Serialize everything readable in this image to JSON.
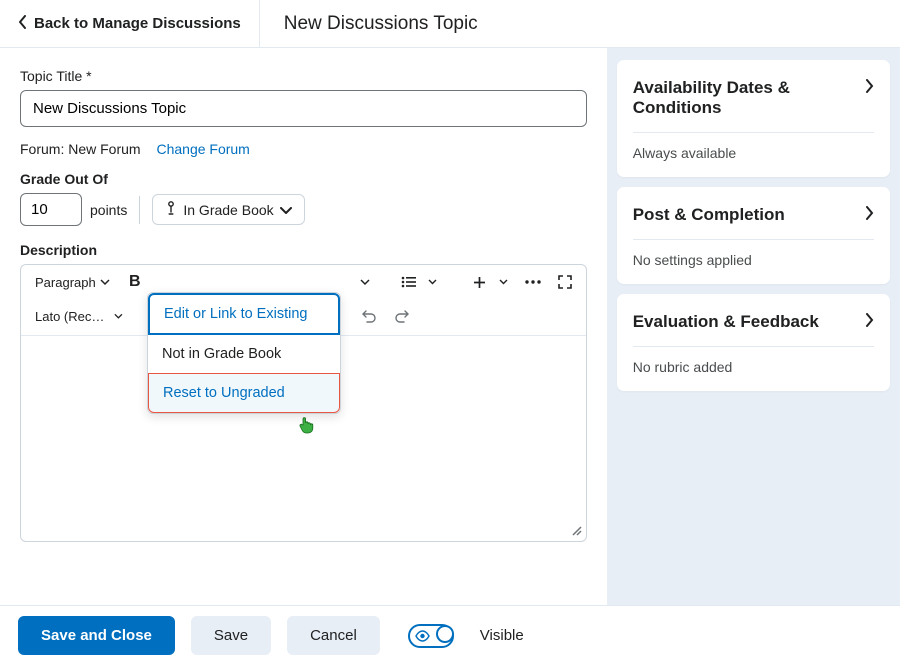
{
  "header": {
    "back_label": "Back to Manage Discussions",
    "page_title": "New Discussions Topic"
  },
  "topic": {
    "title_label": "Topic Title *",
    "title_value": "New Discussions Topic",
    "forum_prefix": "Forum: New Forum",
    "change_forum": "Change Forum"
  },
  "grade": {
    "label": "Grade Out Of",
    "value": "10",
    "points": "points",
    "dropdown": "In Grade Book"
  },
  "grade_menu": {
    "edit": "Edit or Link to Existing",
    "notin": "Not in Grade Book",
    "reset": "Reset to Ungraded"
  },
  "editor": {
    "label": "Description",
    "paragraph": "Paragraph",
    "font": "Lato (Recom..."
  },
  "panels": {
    "avail": {
      "title": "Availability Dates & Conditions",
      "sub": "Always available"
    },
    "post": {
      "title": "Post & Completion",
      "sub": "No settings applied"
    },
    "eval": {
      "title": "Evaluation & Feedback",
      "sub": "No rubric added"
    }
  },
  "footer": {
    "save_close": "Save and Close",
    "save": "Save",
    "cancel": "Cancel",
    "visible": "Visible"
  }
}
